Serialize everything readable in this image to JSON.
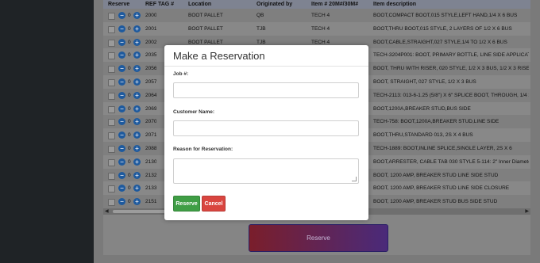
{
  "table": {
    "headers": [
      "Reserve",
      "REF TAG #",
      "Location",
      "Originated by",
      "Item # 20M#/30M#",
      "Item description"
    ],
    "rows": [
      {
        "qty": "0",
        "ref": "2000",
        "loc": "BOOT PALLET",
        "orig": "QB",
        "item": "TECH 4",
        "desc": "BOOT,COMPACT BOOT,015 STYLE,LEFT HAND,1/4 X 6 BUS"
      },
      {
        "qty": "0",
        "ref": "2001",
        "loc": "BOOT PALLET",
        "orig": "TJB",
        "item": "TECH 4",
        "desc": "BOOT,THRU BOOT,015 STYLE, 2 LAYERS OF 1/2 X 6 BUS"
      },
      {
        "qty": "0",
        "ref": "2002",
        "loc": "BOOT PALLET",
        "orig": "TJB",
        "item": "TECH 4",
        "desc": "BOOT,CABLE,STRAIGHT,027 STYLE,1/4 TO 1/2 X 6 BUS"
      },
      {
        "qty": "0",
        "ref": "2035",
        "loc": "",
        "orig": "",
        "item": "",
        "desc": "TECH-3204P001: BOOT, PRIMARY BOTTLE, LINE SIDE APPLICATIONS, 3"
      },
      {
        "qty": "0",
        "ref": "2056",
        "loc": "",
        "orig": "",
        "item": "",
        "desc": "BOOT, THRU WITH RISER, 020 STYLE, 1/2 X 3 BUS, 1/2 X 3 RISER"
      },
      {
        "qty": "0",
        "ref": "2057",
        "loc": "",
        "orig": "",
        "item": "",
        "desc": "BOOT, STRAIGHT, 027 STYLE, 1/2 X 3 BUS"
      },
      {
        "qty": "0",
        "ref": "2064",
        "loc": "",
        "orig": "",
        "item": "",
        "desc": "TECH-2113: 013-6-1.25 (5/8\") X 6\" SPLICE BOOT, THROUGH, 1/4 x 6\" SPLICE"
      },
      {
        "qty": "0",
        "ref": "2069",
        "loc": "",
        "orig": "",
        "item": "",
        "desc": "BOOT,1200A,BREAKER STUD,BUS SIDE"
      },
      {
        "qty": "0",
        "ref": "2070",
        "loc": "",
        "orig": "",
        "item": "",
        "desc": "TECH-758: BOOT,1200A,BREAKER STUD,LINE SIDE"
      },
      {
        "qty": "0",
        "ref": "2071",
        "loc": "",
        "orig": "",
        "item": "",
        "desc": "BOOT,THRU,STANDARD 013, 2S X 4 BUS"
      },
      {
        "qty": "0",
        "ref": "2088",
        "loc": "",
        "orig": "",
        "item": "",
        "desc": "TECH-1889: BOOT,INLINE SPLICE,SINGLE LAYER, 2S X 6"
      },
      {
        "qty": "0",
        "ref": "2130",
        "loc": "",
        "orig": "",
        "item": "",
        "desc": "BOOT,ARRESTER, CABLE TAB 030 STYLE 5-114: 2\" Inner Diameter with"
      },
      {
        "qty": "0",
        "ref": "2132",
        "loc": "",
        "orig": "",
        "item": "",
        "desc": "BOOT, 1200 AMP, BREAKER STUD LINE SIDE STUD"
      },
      {
        "qty": "0",
        "ref": "2133",
        "loc": "",
        "orig": "",
        "item": "",
        "desc": "BOOT, 1200 AMP, BREAKER STUD LINE SIDE CLOSURE"
      },
      {
        "qty": "0",
        "ref": "2151",
        "loc": "",
        "orig": "",
        "item": "",
        "desc": "BOOT, 1200 AMP, BREAKER STUD BUS SIDE STUD"
      }
    ]
  },
  "reserve_button_label": "Reserve",
  "modal": {
    "title": "Make a Reservation",
    "job_label": "Job #:",
    "customer_label": "Customer Name:",
    "reason_label": "Reason for Reservation:",
    "reserve_label": "Reserve",
    "cancel_label": "Cancel"
  },
  "colors": {
    "reserve_green": "#3f9e45",
    "cancel_red": "#d9453f",
    "stepper_blue": "#1e5a9e"
  },
  "icons": {
    "minus": "minus-icon",
    "plus": "plus-icon"
  }
}
